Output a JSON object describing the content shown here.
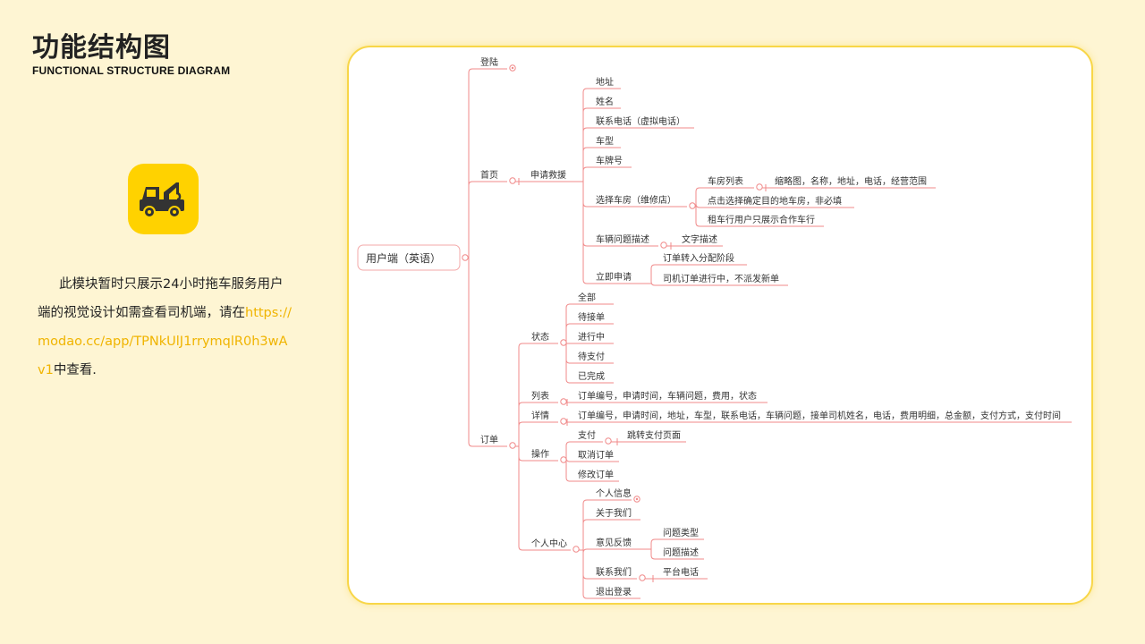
{
  "header": {
    "title": "功能结构图",
    "subtitle": "FUNCTIONAL STRUCTURE DIAGRAM"
  },
  "app_icon": {
    "name": "tow-truck-icon",
    "color": "#ffd200"
  },
  "description": {
    "text_before": "此模块暂时只展示24小时拖车服务用户端的视觉设计如需查看司机端，请在",
    "link": "https://modao.cc/app/TPNkUlJ1rrymqlR0h3wAv1",
    "text_after": "中查看."
  },
  "colors": {
    "branch_line": "#f08a8a",
    "card_border": "#f8d648",
    "accent": "#ffd200",
    "link": "#f0b400"
  },
  "mindmap": {
    "root": "用户端（英语）",
    "nodes": {
      "login": "登陆",
      "home": "首页",
      "apply_rescue": "申请救援",
      "address": "地址",
      "name": "姓名",
      "phone": "联系电话（虚拟电话）",
      "car_model": "车型",
      "plate": "车牌号",
      "choose_shop": "选择车房（维修店）",
      "shop_list": "车房列表",
      "shop_list_detail": "缩略图，名称，地址，电话，经营范围",
      "click_confirm": "点击选择确定目的地车房，非必填",
      "coop_note": "租车行用户只展示合作车行",
      "problem_desc": "车辆问题描述",
      "text_desc": "文字描述",
      "apply_now": "立即申请",
      "order_to_assign": "订单转入分配阶段",
      "driver_in_progress": "司机订单进行中，不派发新单",
      "orders": "订单",
      "status": "状态",
      "all": "全部",
      "pending_accept": "待接单",
      "in_progress": "进行中",
      "pending_pay": "待支付",
      "done": "已完成",
      "list": "列表",
      "list_fields": "订单编号，申请时间，车辆问题，费用，状态",
      "detail": "详情",
      "detail_fields": "订单编号，申请时间，地址，车型，联系电话，车辆问题，接单司机姓名，电话，费用明细，总金额，支付方式，支付时间",
      "actions": "操作",
      "pay": "支付",
      "goto_pay": "跳转支付页面",
      "cancel_order": "取消订单",
      "edit_order": "修改订单",
      "personal": "个人中心",
      "profile": "个人信息",
      "about": "关于我们",
      "feedback": "意见反馈",
      "issue_type": "问题类型",
      "issue_desc": "问题描述",
      "contact": "联系我们",
      "platform_phone": "平台电话",
      "logout": "退出登录"
    }
  }
}
